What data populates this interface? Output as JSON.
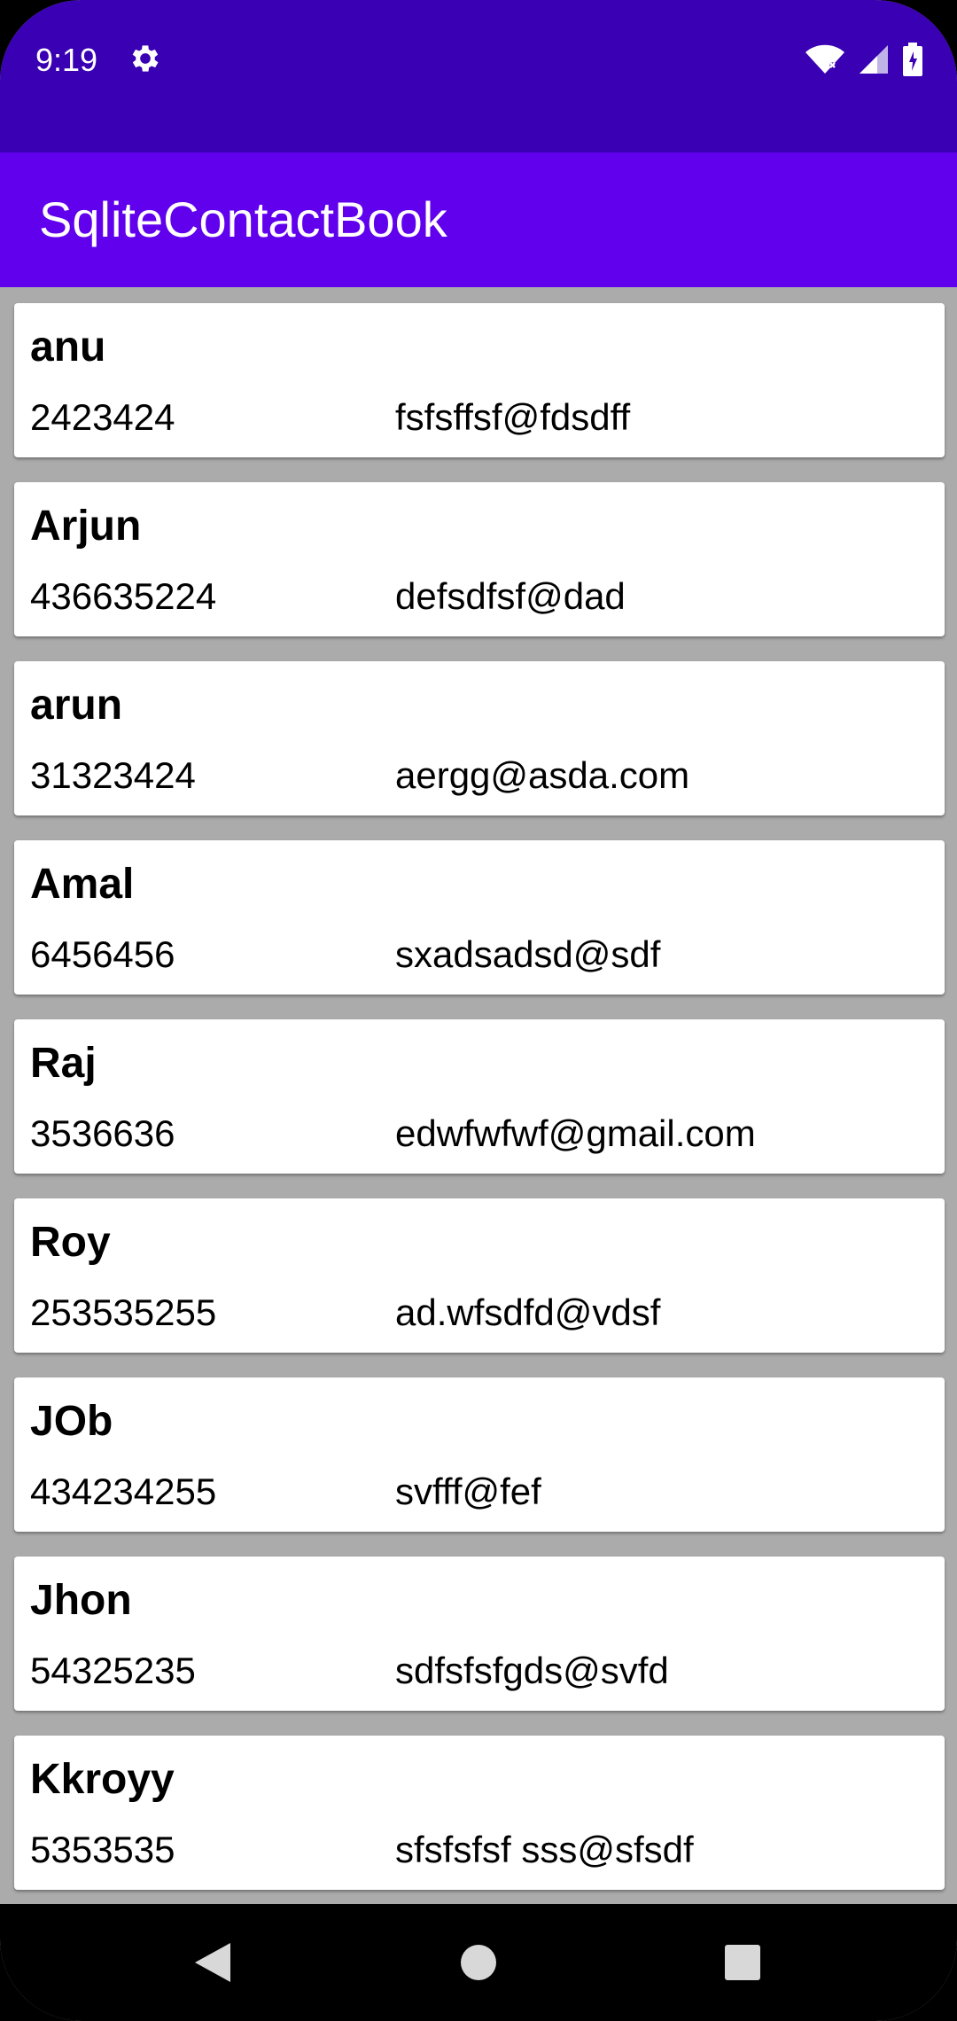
{
  "status_bar": {
    "time": "9:19",
    "icons": [
      "gear-icon",
      "wifi-icon",
      "signal-icon",
      "battery-icon"
    ]
  },
  "app_bar": {
    "title": "SqliteContactBook"
  },
  "contacts": [
    {
      "name": "anu",
      "phone": "2423424",
      "email": "fsfsffsf@fdsdff"
    },
    {
      "name": "Arjun",
      "phone": "436635224",
      "email": "defsdfsf@dad"
    },
    {
      "name": "arun",
      "phone": "31323424",
      "email": "aergg@asda.com"
    },
    {
      "name": "Amal",
      "phone": "6456456",
      "email": "sxadsadsd@sdf"
    },
    {
      "name": "Raj",
      "phone": "3536636",
      "email": "edwfwfwf@gmail.com"
    },
    {
      "name": "Roy",
      "phone": "253535255",
      "email": "ad.wfsdfd@vdsf"
    },
    {
      "name": "JOb",
      "phone": "434234255",
      "email": "svfff@fef"
    },
    {
      "name": "Jhon",
      "phone": "54325235",
      "email": "sdfsfsfgds@svfd"
    },
    {
      "name": "Kkroyy",
      "phone": "5353535",
      "email": "sfsfsfsf sss@sfsdf"
    }
  ],
  "nav_bar": {
    "icons": [
      "back-icon",
      "home-icon",
      "recents-icon"
    ]
  },
  "colors": {
    "status_bar": "#3a00b3",
    "app_bar": "#6100ed",
    "list_bg": "#ababab"
  }
}
